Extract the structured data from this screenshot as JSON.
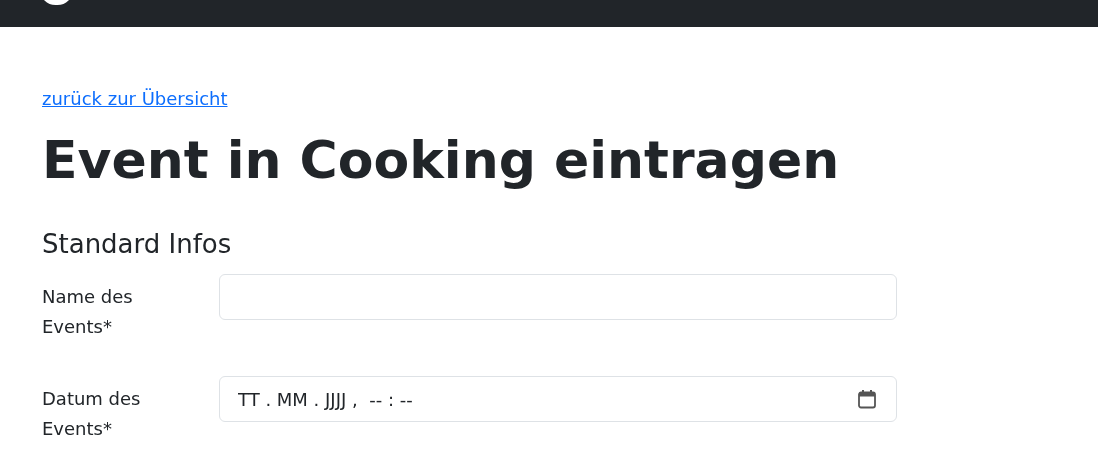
{
  "back_link": "zurück zur Übersicht",
  "title": "Event in Cooking eintragen",
  "section": "Standard Infos",
  "fields": [
    {
      "kind": "text",
      "label": "Name des Events*"
    },
    {
      "kind": "datetime",
      "label": "Datum des Events*",
      "placeholder": "TT . MM . JJJJ ,  -- : --"
    }
  ]
}
